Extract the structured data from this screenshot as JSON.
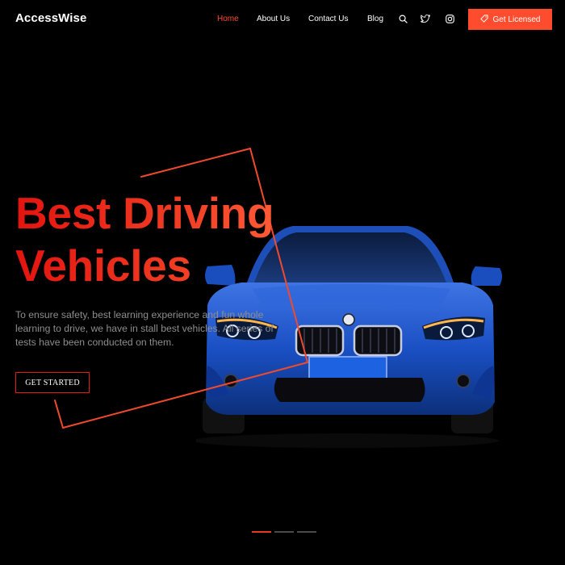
{
  "brand": "AccessWise",
  "nav": [
    {
      "label": "Home",
      "active": true
    },
    {
      "label": "About Us",
      "active": false
    },
    {
      "label": "Contact Us",
      "active": false
    },
    {
      "label": "Blog",
      "active": false
    }
  ],
  "icons": [
    "search-icon",
    "twitter-icon",
    "instagram-icon",
    "tag-icon"
  ],
  "cta_label": "Get Licensed",
  "hero": {
    "title_line1": "Best Driving",
    "title_line2": "Vehicles",
    "description": "To ensure safety, best learning experience and fun whole learning to drive, we have in stall best vehicles. All series of tests have been conducted on them.",
    "button_label": "GET STARTED"
  },
  "slider": {
    "count": 3,
    "active_index": 0
  },
  "colors": {
    "accent": "#ff4c2e",
    "title_red": "#e81a13",
    "background": "#000000",
    "car_blue": "#1a50c4"
  }
}
